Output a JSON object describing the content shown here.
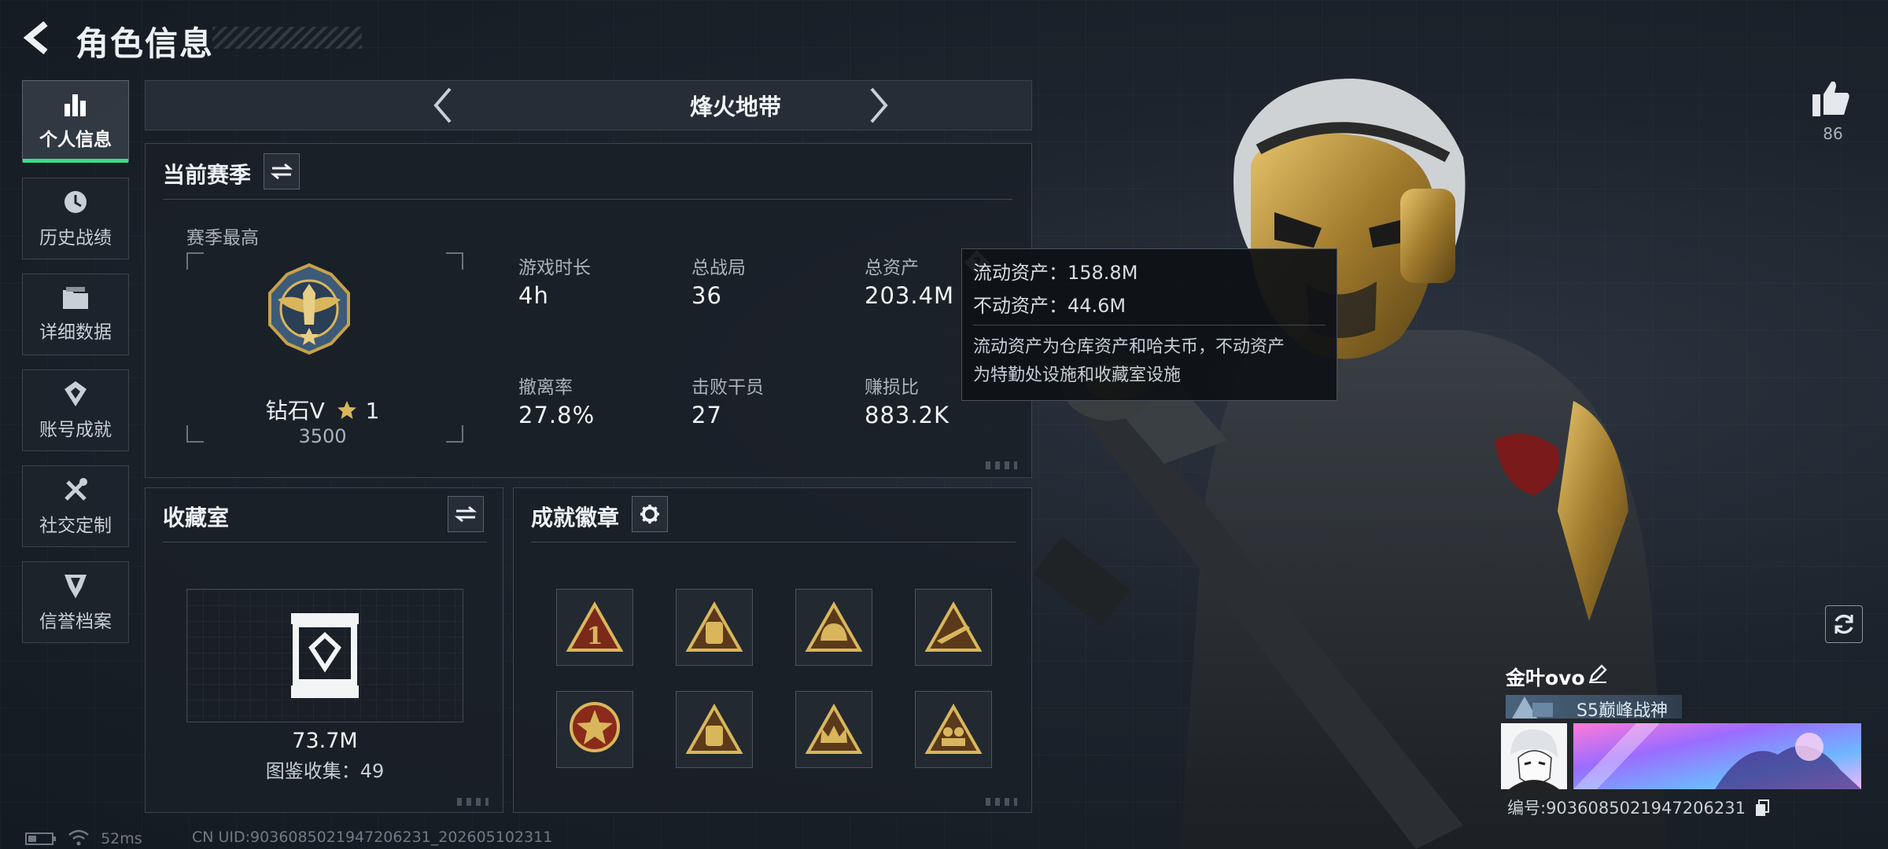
{
  "header": {
    "title": "角色信息"
  },
  "sidebar": {
    "items": [
      {
        "label": "个人信息",
        "icon": "bar-chart-icon",
        "active": true
      },
      {
        "label": "历史战绩",
        "icon": "history-clock-icon",
        "active": false
      },
      {
        "label": "详细数据",
        "icon": "folder-icon",
        "active": false
      },
      {
        "label": "账号成就",
        "icon": "achievement-icon",
        "active": false
      },
      {
        "label": "社交定制",
        "icon": "tools-icon",
        "active": false
      },
      {
        "label": "信誉档案",
        "icon": "credit-badge-icon",
        "active": false
      }
    ]
  },
  "mode": {
    "name": "烽火地带"
  },
  "season": {
    "title": "当前赛季",
    "best_label": "赛季最高",
    "rank_name": "钻石V",
    "rank_stars": "1",
    "rank_score": "3500",
    "stats": [
      {
        "label": "游戏时长",
        "value": "4h"
      },
      {
        "label": "总战局",
        "value": "36"
      },
      {
        "label": "总资产",
        "value": "203.4M"
      },
      {
        "label": "撤离率",
        "value": "27.8%"
      },
      {
        "label": "击败干员",
        "value": "27"
      },
      {
        "label": "赚损比",
        "value": "883.2K"
      }
    ]
  },
  "tooltip": {
    "liquid": "流动资产：158.8M",
    "fixed": "不动资产：44.6M",
    "desc_line1": "流动资产为仓库资产和哈夫币，不动资产",
    "desc_line2": "为特勤处设施和收藏室设施"
  },
  "collection": {
    "title": "收藏室",
    "value": "73.7M",
    "catalog": "图鉴收集：49"
  },
  "achievements": {
    "title": "成就徽章",
    "badges": [
      "badge-rank-1-icon",
      "badge-backpack-icon",
      "badge-helmet-icon",
      "badge-rifle-icon",
      "badge-star-medal-icon",
      "badge-s8-backpack-icon",
      "badge-crown-icon",
      "badge-squad-icon"
    ]
  },
  "profile": {
    "like_count": "86",
    "name": "金叶ovo",
    "title_tag": "S5巅峰战神",
    "uid_line": "编号:9036085021947206231"
  },
  "status_bar": {
    "ping": "52ms",
    "cn_uid": "CN UID:9036085021947206231_202605102311"
  },
  "colors": {
    "accent_green": "#3ddc84",
    "gold": "#c8a24a"
  }
}
